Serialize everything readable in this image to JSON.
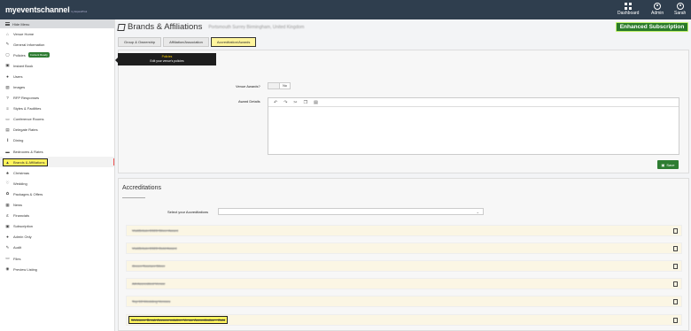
{
  "app": {
    "logo": "myeventschannel",
    "logo_sub": "by ExpandTrek",
    "nav": [
      {
        "label": "Dashboard",
        "icon": "dashboard-icon"
      },
      {
        "label": "Admin",
        "icon": "admin-icon"
      },
      {
        "label": "Sarah",
        "icon": "user-icon"
      }
    ]
  },
  "sidebar": {
    "hide_menu": "Hide Menu",
    "items": [
      {
        "label": "Venue Home",
        "icon": "home-icon"
      },
      {
        "label": "General Information",
        "icon": "info-icon"
      },
      {
        "label": "Policies",
        "icon": "policies-icon",
        "badge": "Content Ready"
      },
      {
        "label": "Instant Book",
        "icon": "book-icon"
      },
      {
        "label": "Users",
        "icon": "users-icon"
      },
      {
        "label": "Images",
        "icon": "images-icon"
      },
      {
        "label": "RFP Responses",
        "icon": "question-icon"
      },
      {
        "label": "Styles & Facilities",
        "icon": "styles-icon"
      },
      {
        "label": "Conference Rooms",
        "icon": "conference-icon"
      },
      {
        "label": "Delegate Rates",
        "icon": "rates-icon"
      },
      {
        "label": "Dining",
        "icon": "dining-icon"
      },
      {
        "label": "Bedrooms & Rates",
        "icon": "bed-icon"
      },
      {
        "label": "Brands & Affiliations",
        "icon": "brands-icon"
      },
      {
        "label": "Christmas",
        "icon": "christmas-icon"
      },
      {
        "label": "Wedding",
        "icon": "heart-icon"
      },
      {
        "label": "Packages & Offers",
        "icon": "packages-icon"
      },
      {
        "label": "News",
        "icon": "news-icon"
      },
      {
        "label": "Financials",
        "icon": "financials-icon"
      },
      {
        "label": "Subscription",
        "icon": "subscription-icon"
      },
      {
        "label": "Admin Only",
        "icon": "admin-only-icon"
      },
      {
        "label": "Audit",
        "icon": "audit-icon"
      },
      {
        "label": "Files",
        "icon": "files-icon"
      },
      {
        "label": "Preview Listing",
        "icon": "eye-icon"
      }
    ]
  },
  "tooltip": {
    "title": "Policies",
    "text": "Edit your venue's policies"
  },
  "header": {
    "title": "Brands & Affiliations",
    "venue": "Portsmouth Surrey Birmingham, United Kingdom",
    "subscription": "Enhanced Subscription"
  },
  "tabs": [
    {
      "label": "Group & Ownership"
    },
    {
      "label": "Affiliation/Association"
    },
    {
      "label": "Accreditation/Awards"
    }
  ],
  "awards": {
    "venue_awards_label": "Venue Awards?",
    "toggle_value": "No",
    "award_details_label": "Award Details",
    "save_label": "Save"
  },
  "accreditations": {
    "title": "Accreditations",
    "select_label": "Select your Accreditations",
    "rows": [
      {
        "label": "VisitBritain 2023 Silver Award"
      },
      {
        "label": "VisitBritain 2023 Gold Award"
      },
      {
        "label": "Green Tourism Silver"
      },
      {
        "label": "AA Accredited Venue"
      },
      {
        "label": "Top 10 Wedding Venues"
      },
      {
        "label": "Welcome Break Accommodation Venue Accreditation - Gold"
      }
    ]
  }
}
